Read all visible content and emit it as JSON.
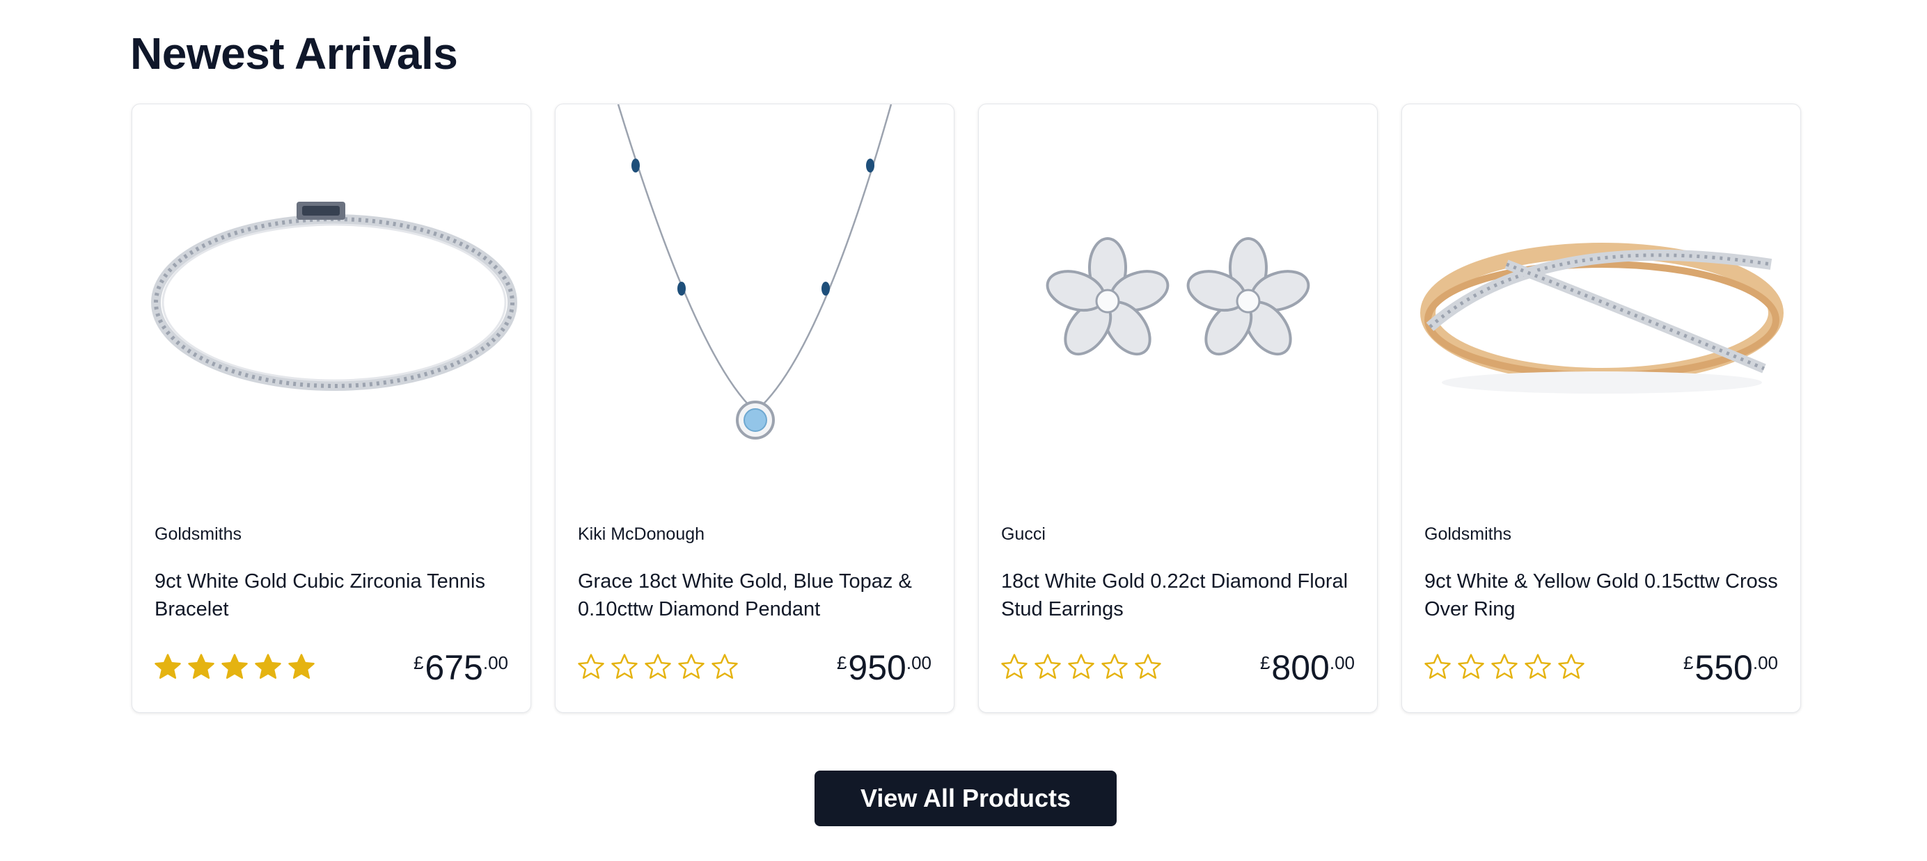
{
  "section": {
    "title": "Newest Arrivals"
  },
  "colors": {
    "star": "#E5B311",
    "button_bg": "#111827",
    "button_text": "#FFFFFF"
  },
  "products": [
    {
      "brand": "Goldsmiths",
      "name": "9ct White Gold Cubic Zirconia Tennis Bracelet",
      "image_icon": "tennis-bracelet-image",
      "rating": 5,
      "max_rating": 5,
      "currency": "£",
      "price_whole": "675",
      "price_cents": ".00"
    },
    {
      "brand": "Kiki McDonough",
      "name": "Grace 18ct White Gold, Blue Topaz & 0.10cttw Diamond Pendant",
      "image_icon": "pendant-necklace-image",
      "rating": 0,
      "max_rating": 5,
      "currency": "£",
      "price_whole": "950",
      "price_cents": ".00"
    },
    {
      "brand": "Gucci",
      "name": "18ct White Gold 0.22ct Diamond Floral Stud Earrings",
      "image_icon": "flower-earrings-image",
      "rating": 0,
      "max_rating": 5,
      "currency": "£",
      "price_whole": "800",
      "price_cents": ".00"
    },
    {
      "brand": "Goldsmiths",
      "name": "9ct White & Yellow Gold 0.15cttw Cross Over Ring",
      "image_icon": "cross-over-ring-image",
      "rating": 0,
      "max_rating": 5,
      "currency": "£",
      "price_whole": "550",
      "price_cents": ".00"
    }
  ],
  "cta": {
    "label": "View All Products"
  }
}
